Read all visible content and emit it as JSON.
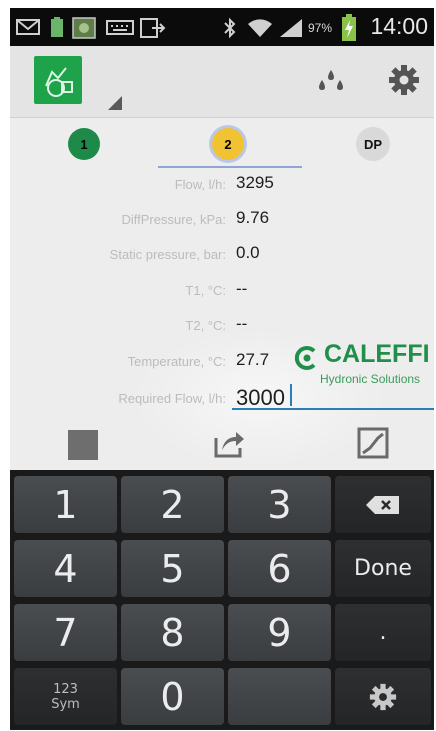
{
  "status_bar": {
    "battery_percent": "97%",
    "time": "14:00",
    "icons": [
      "mail-icon",
      "battery-app-icon",
      "photo-icon",
      "keyboard-icon",
      "screen-cast-icon",
      "bluetooth-icon",
      "wifi-icon",
      "signal-icon",
      "charging-icon"
    ]
  },
  "action_bar": {
    "icons": [
      "app-logo-icon",
      "drops-icon",
      "gear-icon"
    ]
  },
  "tabs": [
    {
      "label": "1",
      "color": "#1e8a49"
    },
    {
      "label": "2",
      "color": "#f1c232",
      "active": true
    },
    {
      "label": "DP",
      "color": "#d9d9d9"
    }
  ],
  "fields": [
    {
      "label": "Flow, l/h:",
      "value": "3295"
    },
    {
      "label": "DiffPressure, kPa:",
      "value": "9.76"
    },
    {
      "label": "Static pressure, bar:",
      "value": "0.0"
    },
    {
      "label": "T1, °C:",
      "value": "--"
    },
    {
      "label": "T2, °C:",
      "value": "--"
    },
    {
      "label": "Temperature, °C:",
      "value": "27.7"
    },
    {
      "label": "Required Flow, l/h:",
      "value": "3000"
    }
  ],
  "brand": {
    "name": "CALEFFI",
    "tagline": "Hydronic Solutions",
    "color": "#1f8f4a"
  },
  "toolbar": {
    "icons": [
      "stop-icon",
      "share-icon",
      "graph-icon"
    ]
  },
  "keyboard": {
    "rows": [
      [
        "1",
        "2",
        "3",
        "⌫"
      ],
      [
        "4",
        "5",
        "6",
        "Done"
      ],
      [
        "7",
        "8",
        "9",
        "."
      ],
      [
        "123 Sym",
        "0",
        "",
        "⚙"
      ]
    ],
    "sym_line1": "123",
    "sym_line2": "Sym",
    "done_label": "Done"
  }
}
